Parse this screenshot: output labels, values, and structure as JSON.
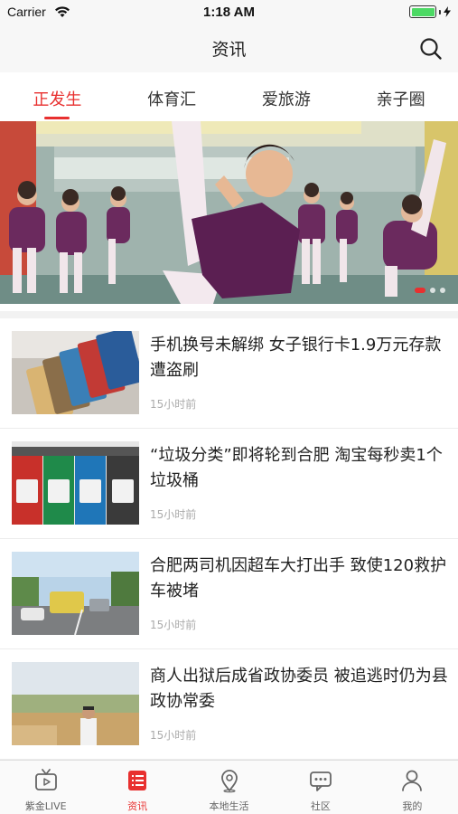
{
  "status_bar": {
    "carrier": "Carrier",
    "time": "1:18 AM",
    "battery_color": "#4cd964"
  },
  "header": {
    "title": "资讯",
    "search_icon": "search-icon"
  },
  "tabs": [
    {
      "label": "正发生",
      "active": true
    },
    {
      "label": "体育汇",
      "active": false
    },
    {
      "label": "爱旅游",
      "active": false
    },
    {
      "label": "亲子圈",
      "active": false
    }
  ],
  "banner": {
    "image": "ballet-class-children-stretching",
    "pagination": {
      "count": 3,
      "active_index": 0
    }
  },
  "news": [
    {
      "title": "手机换号未解绑 女子银行卡1.9万元存款遭盗刷",
      "time": "15小时前",
      "thumb": "bank-cards"
    },
    {
      "title": "“垃圾分类”即将轮到合肥 淘宝每秒卖1个垃圾桶",
      "time": "15小时前",
      "thumb": "trash-bins"
    },
    {
      "title": "合肥两司机因超车大打出手 致使120救护车被堵",
      "time": "15小时前",
      "thumb": "traffic-road"
    },
    {
      "title": "商人出狱后成省政协委员 被追逃时仍为县政协常委",
      "time": "15小时前",
      "thumb": "man-outdoors"
    }
  ],
  "tabbar": [
    {
      "label": "紫金LIVE",
      "icon": "tv-icon",
      "active": false
    },
    {
      "label": "资讯",
      "icon": "news-icon",
      "active": true
    },
    {
      "label": "本地生活",
      "icon": "location-pin-icon",
      "active": false
    },
    {
      "label": "社区",
      "icon": "chat-bubble-icon",
      "active": false
    },
    {
      "label": "我的",
      "icon": "person-icon",
      "active": false
    }
  ],
  "colors": {
    "accent": "#e8302f",
    "nav_bg": "#f7f7f7",
    "text": "#222222",
    "muted": "#aaaaaa"
  }
}
